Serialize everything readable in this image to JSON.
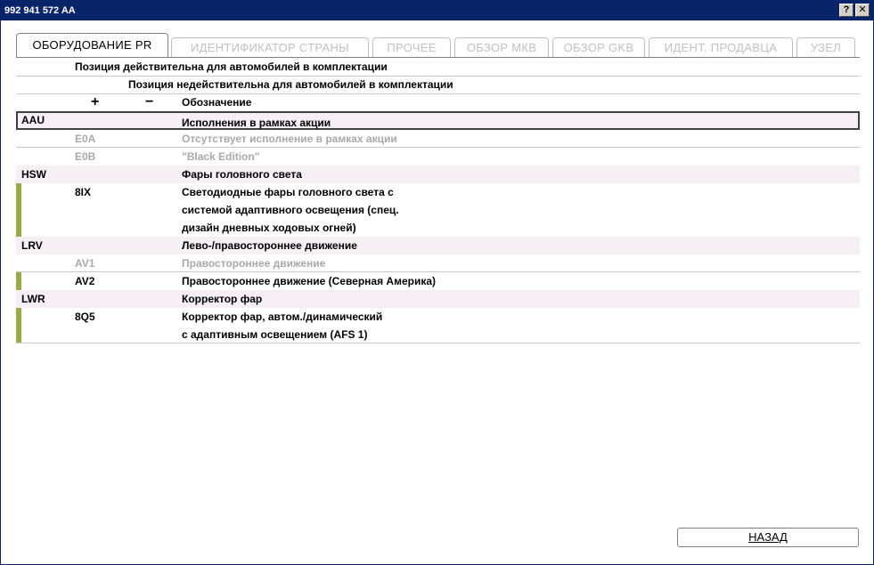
{
  "window": {
    "title": "992 941 572 AA",
    "help_label": "?",
    "close_label": "✕"
  },
  "tabs": [
    {
      "label": "ОБОРУДОВАНИЕ PR",
      "active": true
    },
    {
      "label": "ИДЕНТИФИКАТОР СТРАНЫ",
      "active": false
    },
    {
      "label": "ПРОЧЕЕ",
      "active": false
    },
    {
      "label": "ОБЗОР МКВ",
      "active": false
    },
    {
      "label": "ОБЗОР GKB",
      "active": false
    },
    {
      "label": "ИДЕНТ. ПРОДАВЦА",
      "active": false
    },
    {
      "label": "УЗЕЛ",
      "active": false
    }
  ],
  "legend": {
    "valid": "Позиция действительна для автомобилей в комплектации",
    "invalid": "Позиция недействительна для автомобилей в комплектации"
  },
  "table_header": {
    "plus": "+",
    "minus": "−",
    "designation": "Обозначение"
  },
  "rows": [
    {
      "kind": "group",
      "code": "AAU",
      "desc": "Исполнения в рамках акции"
    },
    {
      "kind": "item",
      "code": "E0A",
      "desc": "Отсутствует исполнение в рамках акции"
    },
    {
      "kind": "item",
      "code": "E0B",
      "desc": "\"Black Edition\""
    },
    {
      "kind": "group",
      "code": "HSW",
      "desc": "Фары головного света"
    },
    {
      "kind": "item",
      "code": "8IX",
      "desc_lines": [
        "Светодиодные фары головного света с",
        "системой адаптивного освещения (спец.",
        "дизайн дневных ходовых огней)"
      ]
    },
    {
      "kind": "group",
      "code": "LRV",
      "desc": "Лево-/правостороннее движение"
    },
    {
      "kind": "item",
      "code": "AV1",
      "desc": "Правостороннее движение"
    },
    {
      "kind": "item",
      "code": "AV2",
      "desc": "Правостороннее движение (Северная Америка)"
    },
    {
      "kind": "group",
      "code": "LWR",
      "desc": "Корректор фар"
    },
    {
      "kind": "item",
      "code": "8Q5",
      "desc_lines": [
        "Корректор фар, автом./динамический",
        "с адаптивным освещением (AFS 1)"
      ]
    }
  ],
  "colors": {
    "valid_marker": "#9aaa48",
    "title_bar": "#0a246a",
    "disabled_text": "#a8a8a8",
    "group_bg": "#f5eef3"
  },
  "buttons": {
    "back": "НАЗАД"
  }
}
